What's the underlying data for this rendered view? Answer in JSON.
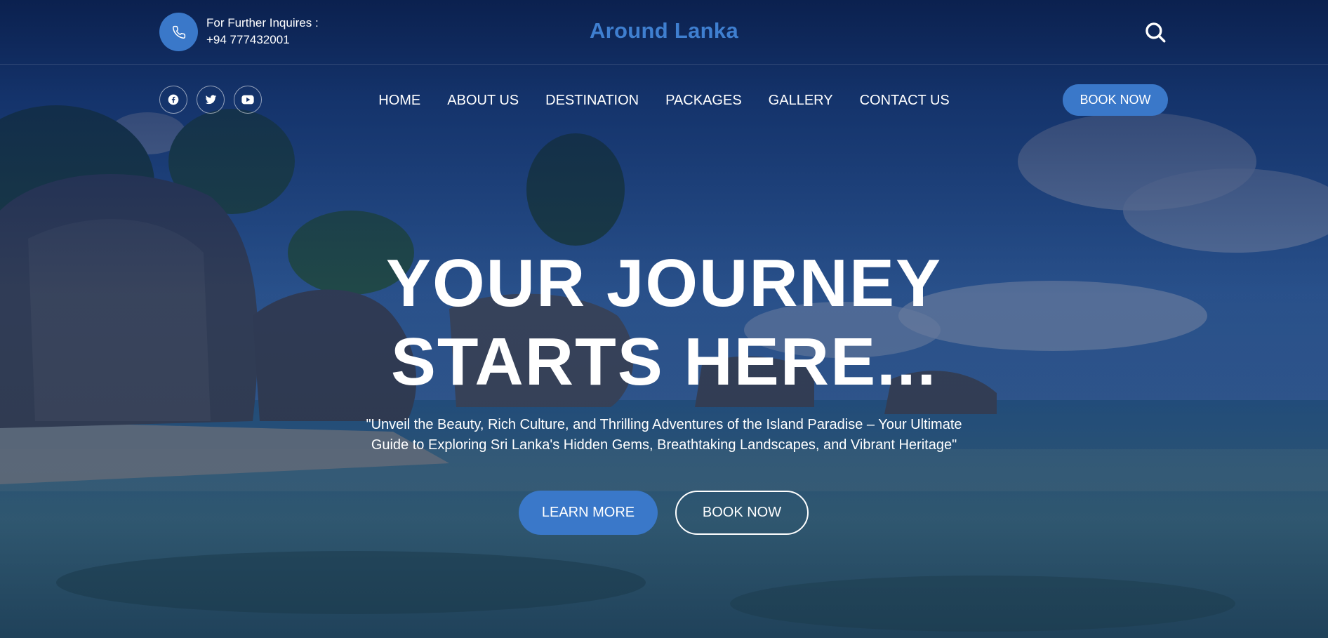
{
  "header": {
    "inquire_label": "For Further Inquires :",
    "phone": "+94 777432001",
    "brand": "Around Lanka",
    "icons": {
      "phone": "phone-icon",
      "search": "search-icon"
    }
  },
  "social": [
    {
      "icon": "facebook-icon"
    },
    {
      "icon": "twitter-icon"
    },
    {
      "icon": "youtube-icon"
    }
  ],
  "nav": {
    "items": [
      {
        "label": "HOME"
      },
      {
        "label": "ABOUT US"
      },
      {
        "label": "DESTINATION"
      },
      {
        "label": "PACKAGES"
      },
      {
        "label": "GALLERY"
      },
      {
        "label": "CONTACT US"
      }
    ],
    "book_label": "BOOK NOW"
  },
  "hero": {
    "headline_line1": "YOUR JOURNEY",
    "headline_line2": "STARTS HERE...",
    "tagline": "\"Unveil the Beauty, Rich Culture, and Thrilling Adventures of the Island Paradise – Your Ultimate Guide to Exploring Sri Lanka's Hidden Gems, Breathtaking Landscapes, and Vibrant Heritage\"",
    "learn_more_label": "LEARN MORE",
    "book_now_label": "BOOK NOW"
  },
  "colors": {
    "accent": "#3a78c9",
    "brand": "#3f7fd0",
    "overlay": "#0b1e4a"
  }
}
